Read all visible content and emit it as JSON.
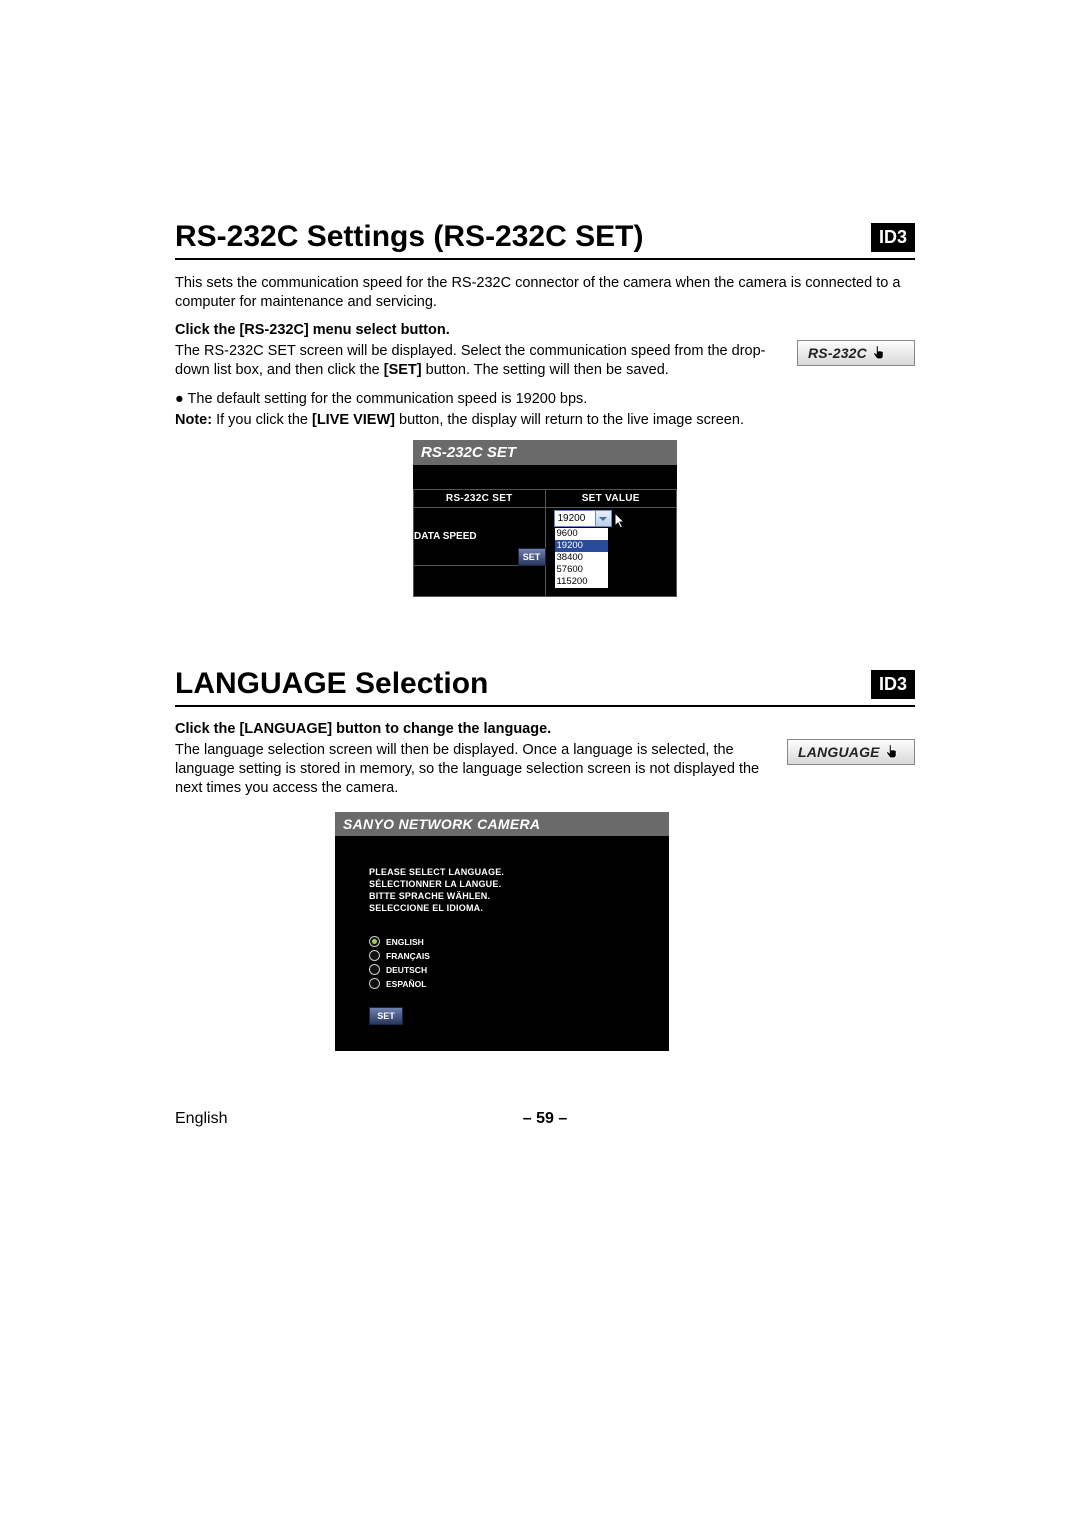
{
  "badges": {
    "id3": "ID3"
  },
  "rs232": {
    "heading": "RS-232C Settings (RS-232C SET)",
    "intro": "This sets the communication speed for the RS-232C connector of the camera when the camera is connected to a computer for maintenance and servicing.",
    "step_title": "Click the [RS-232C] menu select button.",
    "step_body_a": "The RS-232C SET screen will be displayed. Select the communication speed from the drop-down list box, and then click the ",
    "step_body_set": "[SET]",
    "step_body_b": " button. The setting will then be saved.",
    "bullet": "●  The default setting for the communication speed is 19200 bps.",
    "note_label": "Note:",
    "note_a": "  If you click the ",
    "note_bold": "[LIVE VIEW]",
    "note_b": " button, the display will return to the live image screen.",
    "menu_button_label": "RS-232C",
    "panel": {
      "title": "RS-232C SET",
      "col1": "RS-232C SET",
      "col2": "SET VALUE",
      "row_label": "DATA SPEED",
      "selected": "19200",
      "options": [
        "9600",
        "19200",
        "38400",
        "57600",
        "115200"
      ],
      "set_label": "SET"
    }
  },
  "lang": {
    "heading": "LANGUAGE Selection",
    "step_title": "Click the [LANGUAGE] button to change the language.",
    "step_body": "The language selection screen will then be displayed. Once a language is selected, the language setting is stored in memory, so the language selection screen is not displayed the next times you access the camera.",
    "menu_button_label": "LANGUAGE",
    "panel": {
      "title": "SANYO NETWORK CAMERA",
      "prompt": [
        "PLEASE SELECT LANGUAGE.",
        "SÉLECTIONNER LA LANGUE.",
        "BITTE SPRACHE WÄHLEN.",
        "SELECCIONE EL IDIOMA."
      ],
      "options": [
        "ENGLISH",
        "FRANÇAIS",
        "DEUTSCH",
        "ESPAÑOL"
      ],
      "selected_index": 0,
      "set_label": "SET"
    }
  },
  "footer": {
    "lang": "English",
    "page": "– 59 –"
  }
}
